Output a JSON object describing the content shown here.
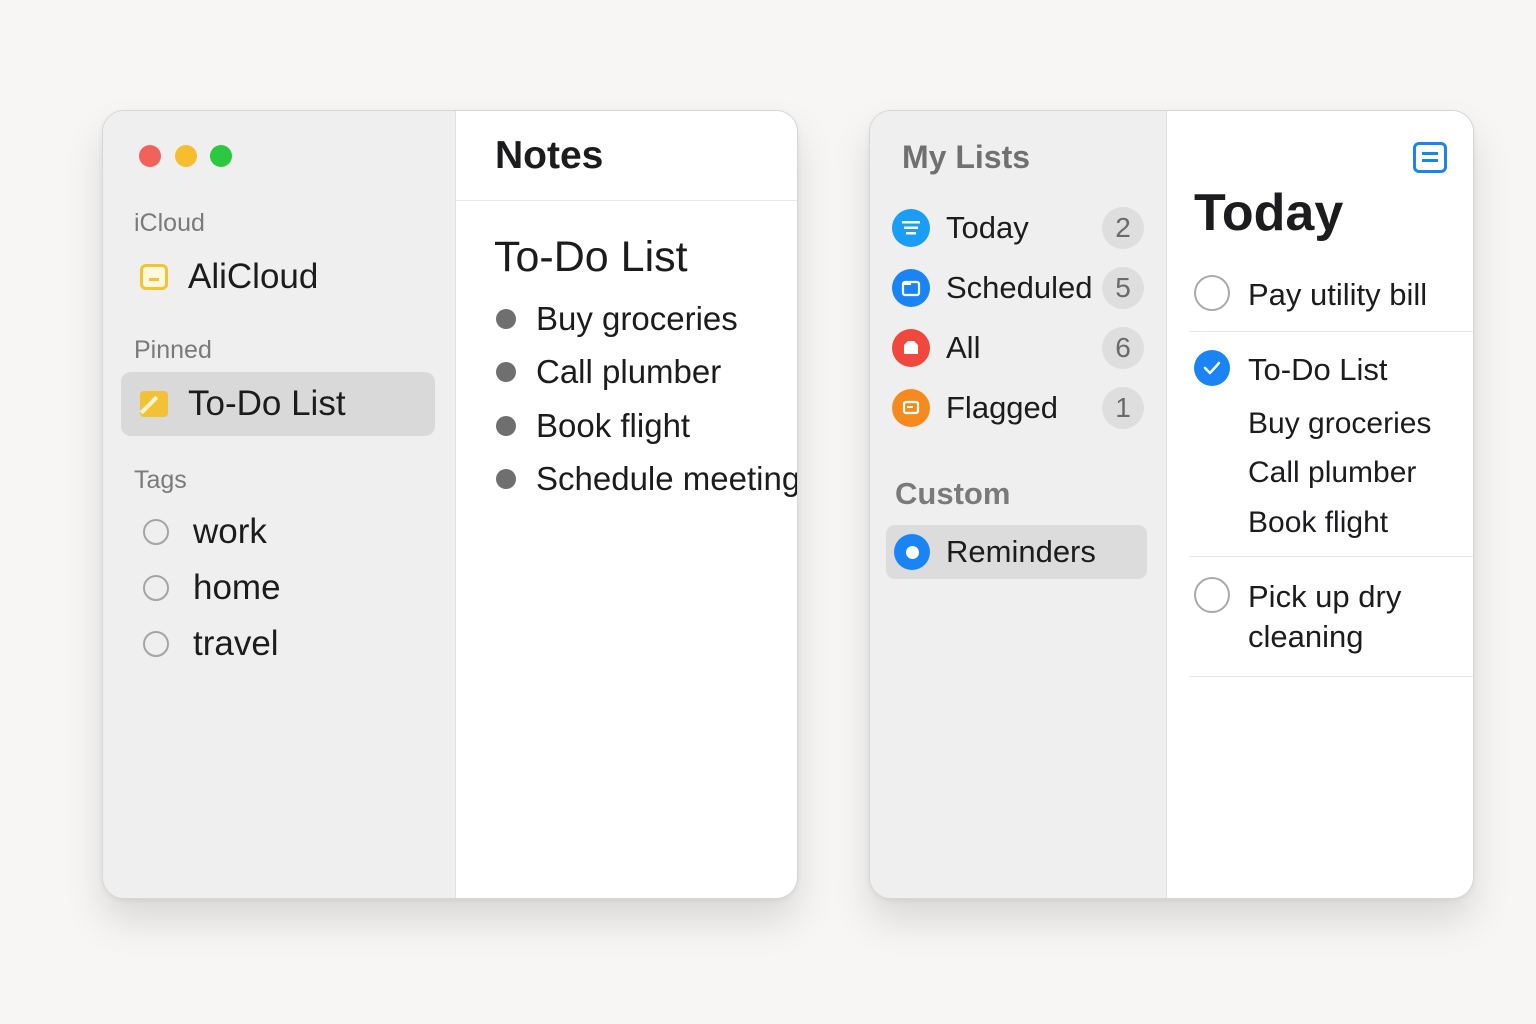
{
  "notes_app": {
    "sidebar": {
      "icloud_label": "iCloud",
      "account": {
        "label": "AliCloud",
        "icon": "folder-icon"
      },
      "pinned_label": "Pinned",
      "pinned_items": [
        {
          "label": "To-Do List",
          "icon": "note-icon",
          "selected": true
        }
      ],
      "tags_label": "Tags",
      "tags": [
        {
          "label": "work"
        },
        {
          "label": "home"
        },
        {
          "label": "travel"
        }
      ]
    },
    "content": {
      "header": "Notes",
      "note_title": "To-Do List",
      "bullets": [
        "Buy groceries",
        "Call plumber",
        "Book flight",
        "Schedule meeting"
      ]
    }
  },
  "reminders_app": {
    "sidebar": {
      "title": "My Lists",
      "lists": [
        {
          "label": "Today",
          "count": "2",
          "icon": "today-icon",
          "color": "#1a9ef5"
        },
        {
          "label": "Scheduled",
          "count": "5",
          "icon": "calendar-icon",
          "color": "#1a84f5"
        },
        {
          "label": "All",
          "count": "6",
          "icon": "tray-icon",
          "color": "#f0483c"
        },
        {
          "label": "Flagged",
          "count": "1",
          "icon": "flag-icon",
          "color": "#f68a1e"
        }
      ],
      "custom_label": "Custom",
      "custom_lists": [
        {
          "label": "Reminders",
          "selected": true,
          "color": "#1a84f5"
        }
      ]
    },
    "content": {
      "title": "Today",
      "items": [
        {
          "label": "Pay utility bill",
          "completed": false
        },
        {
          "label": "To-Do List",
          "completed": true,
          "subtasks": [
            "Buy groceries",
            "Call plumber",
            "Book flight"
          ]
        },
        {
          "label": "Pick up dry cleaning",
          "completed": false
        }
      ]
    }
  },
  "colors": {
    "accent": "#1a84f5",
    "close": "#f0625a",
    "minimize": "#f6bd2e",
    "zoom": "#2bc840",
    "notes_yellow": "#f3c332"
  }
}
